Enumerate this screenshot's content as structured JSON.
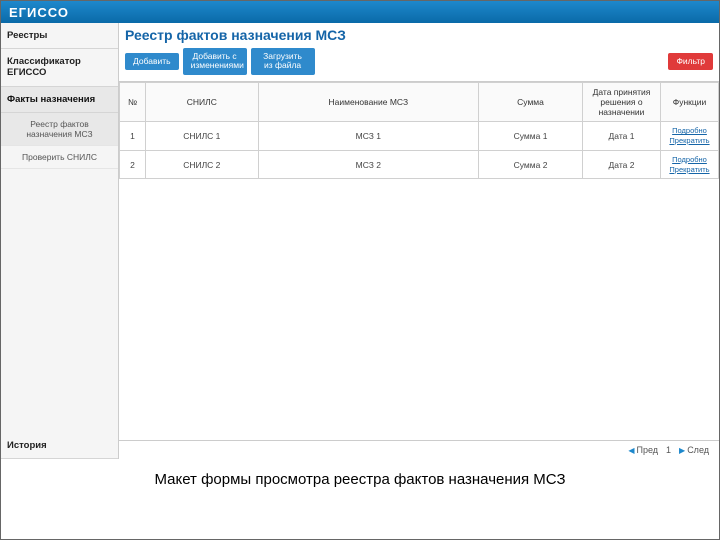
{
  "brand": "ЕГИССО",
  "sidebar": {
    "items": [
      {
        "label": "Реестры"
      },
      {
        "label": "Классификатор ЕГИССО"
      },
      {
        "label": "Факты назначения"
      }
    ],
    "subitems": [
      {
        "label": "Реестр фактов назначения МСЗ"
      },
      {
        "label": "Проверить СНИЛС"
      }
    ],
    "history": "История"
  },
  "page": {
    "title": "Реестр фактов назначения МСЗ"
  },
  "toolbar": {
    "add": "Добавить",
    "add_changes": "Добавить с изменениями",
    "upload": "Загрузить из файла",
    "filter": "Фильтр"
  },
  "table": {
    "headers": {
      "num": "№",
      "snils": "СНИЛС",
      "name": "Наименование МСЗ",
      "sum": "Сумма",
      "date": "Дата принятия решения о назначении",
      "func": "Функции"
    },
    "rows": [
      {
        "num": "1",
        "snils": "СНИЛС 1",
        "name": "МСЗ 1",
        "sum": "Сумма 1",
        "date": "Дата 1"
      },
      {
        "num": "2",
        "snils": "СНИЛС 2",
        "name": "МСЗ 2",
        "sum": "Сумма 2",
        "date": "Дата 2"
      }
    ],
    "func_links": {
      "detail": "Подробно",
      "stop": "Прекратить"
    }
  },
  "pager": {
    "prev": "Пред",
    "page": "1",
    "next": "След"
  },
  "caption": "Макет формы просмотра реестра фактов назначения МСЗ"
}
